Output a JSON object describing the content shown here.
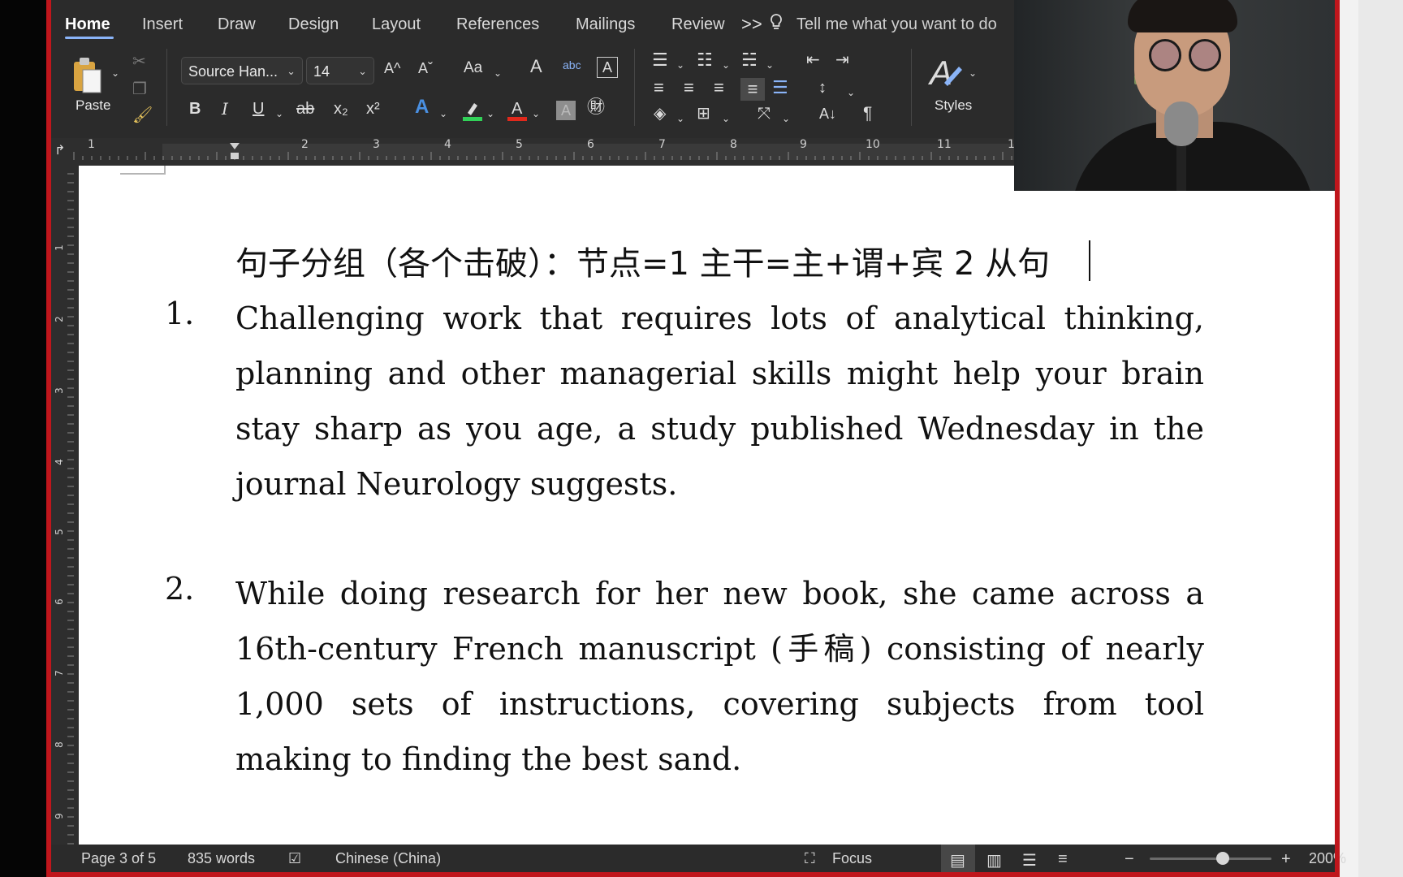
{
  "ribbon": {
    "tabs": [
      "Home",
      "Insert",
      "Draw",
      "Design",
      "Layout",
      "References",
      "Mailings",
      "Review"
    ],
    "active_tab": "Home",
    "more_tabs": ">>",
    "tell_me": "Tell me what you want to do",
    "paste_label": "Paste",
    "font_name": "Source Han...",
    "font_size": "14",
    "styles_label": "Styles",
    "bold": "B",
    "italic": "I",
    "underline": "U",
    "strikethrough": "ab",
    "subscript": "x₂",
    "superscript": "x²",
    "grow_font": "A^",
    "shrink_font": "Aˇ",
    "change_case": "Aa",
    "pilcrow": "¶",
    "colors": {
      "highlight": "#31d158",
      "font_color": "#e0291c",
      "accent": "#8ab4f8"
    }
  },
  "ruler": {
    "numbers": [
      "1",
      "2",
      "3",
      "4",
      "5",
      "6",
      "7",
      "8",
      "9",
      "10",
      "11",
      "1"
    ]
  },
  "vruler": {
    "numbers": [
      "1",
      "2",
      "3",
      "4",
      "5",
      "6",
      "7",
      "8",
      "9"
    ]
  },
  "document": {
    "heading": "句子分组（各个击破）：节点=1 主干=主+谓+宾  2 从句",
    "items": [
      {
        "number": "1.",
        "text": "Challenging work that requires lots of analytical thinking, planning and other managerial skills might help your brain stay sharp as you age, a study published Wednesday in the journal Neurology suggests."
      },
      {
        "number": "2.",
        "text": "While doing research for her new book, she came across a 16th-century French manuscript (手稿) consisting of nearly 1,000 sets of instructions, covering subjects from tool making to finding the best sand."
      }
    ]
  },
  "status": {
    "page": "Page 3 of 5",
    "words": "835 words",
    "language": "Chinese (China)",
    "focus": "Focus",
    "zoom": "200%",
    "zoom_minus": "−",
    "zoom_plus": "+",
    "zoom_level_fraction": 0.55
  }
}
